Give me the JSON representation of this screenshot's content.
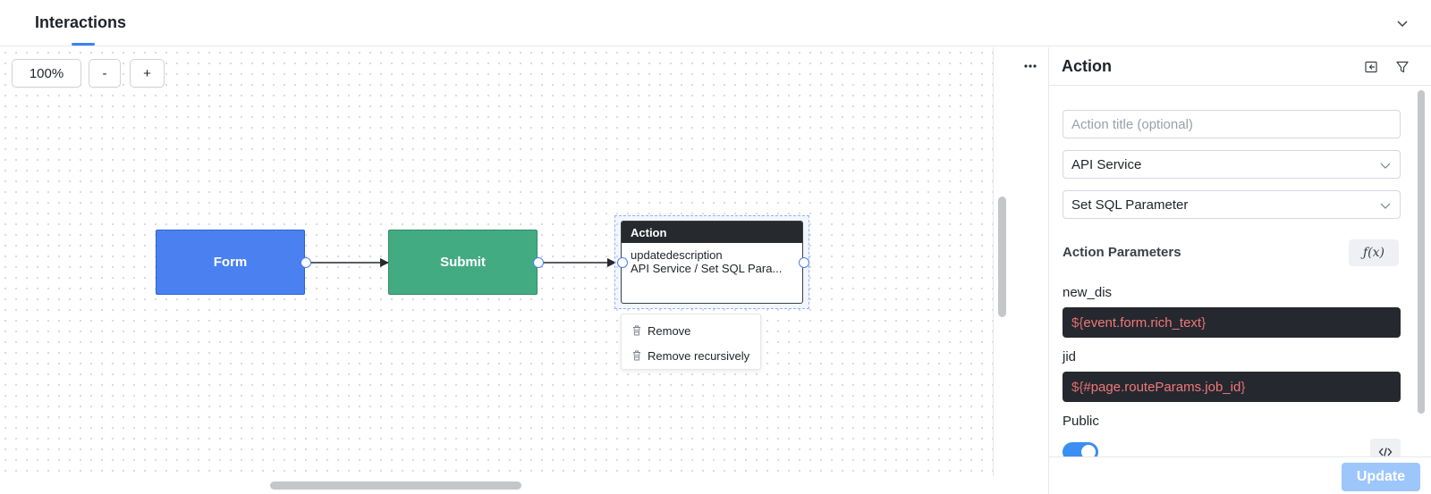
{
  "header": {
    "title": "Interactions"
  },
  "canvas": {
    "zoom": "100%",
    "zoom_out_label": "-",
    "zoom_in_label": "+",
    "nodes": {
      "form": "Form",
      "submit": "Submit",
      "action": {
        "header": "Action",
        "name": "updatedescription",
        "detail": "API Service / Set SQL Para..."
      }
    },
    "context_menu": [
      "Remove",
      "Remove recursively"
    ]
  },
  "panel": {
    "title": "Action",
    "title_placeholder": "Action title (optional)",
    "service": "API Service",
    "operation": "Set SQL Parameter",
    "params_label": "Action Parameters",
    "fx_label": "ƒ(x)",
    "params": [
      {
        "name": "new_dis",
        "open": "${",
        "expr": "event.form.rich_text",
        "close": "}"
      },
      {
        "name": "jid",
        "open": "${",
        "expr": "#page.routeParams.job_id",
        "close": "}"
      }
    ],
    "public_label": "Public",
    "public_on": true,
    "update_label": "Update"
  },
  "colors": {
    "form_node": "#4a80f0",
    "submit_node": "#43ab82",
    "accent": "#3b82f6",
    "update_disabled": "#9dc6fb"
  },
  "icons": [
    "chevron-down-icon",
    "more-icon",
    "exit-panel-icon",
    "filter-icon",
    "trash-icon",
    "code-icon"
  ]
}
